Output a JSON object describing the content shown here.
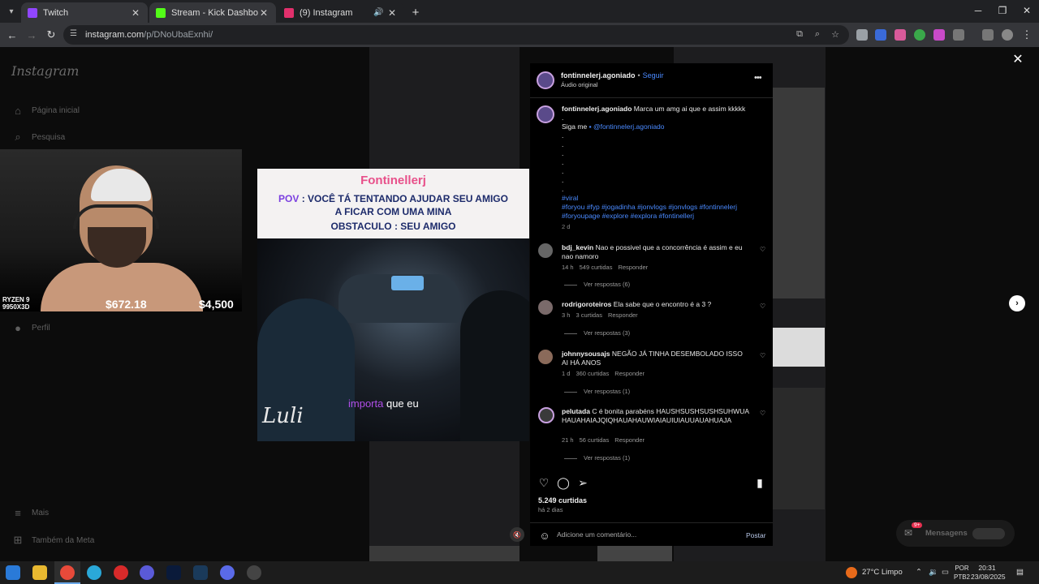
{
  "browser": {
    "tabs": [
      {
        "title": "Twitch",
        "color": "#9146ff"
      },
      {
        "title": "Stream - Kick Dashboard",
        "color": "#53fc18"
      },
      {
        "title": "(9) Instagram",
        "color": "#e1306c"
      }
    ],
    "url_host": "instagram.com",
    "url_path": "/p/DNoUbaExnhi/"
  },
  "sidebar": {
    "logo": "Instagram",
    "items": [
      {
        "label": "Página inicial",
        "icon": "home-icon"
      },
      {
        "label": "Pesquisa",
        "icon": "search-icon"
      },
      {
        "label": "Perfil",
        "icon": "profile-icon"
      },
      {
        "label": "Mais",
        "icon": "menu-icon"
      },
      {
        "label": "Também da Meta",
        "icon": "meta-icon"
      }
    ]
  },
  "webcam": {
    "rig_line1": "RYZEN 9",
    "rig_line2": "9950X3D",
    "money1": "$672.18",
    "money2": "$4,500"
  },
  "video": {
    "brand": "Fontinellerj",
    "line2_pov": "POV",
    "line2_rest": " : VOCÊ TÁ TENTANDO AJUDAR SEU AMIGO",
    "line3": "A FICAR COM UMA MINA",
    "line4": "OBSTACULO : SEU AMIGO",
    "caption_highlight": "importa",
    "caption_rest": " que eu",
    "signature": "Luli"
  },
  "post": {
    "username": "fontinnelerj.agoniado",
    "follow": "Seguir",
    "audio": "Áudio original",
    "caption_text": "Marca um amg ai que e assim kkkkk",
    "siga_me": "Siga me",
    "mention": "@fontinnelerj.agoniado",
    "hashtags_1": "#viral",
    "hashtags_2": "#foryou #fyp #jogadinha #jonvlogs #jonvlogs #fontinnelerj",
    "hashtags_3": "#foryoupage #explore #explora #fontinellerj",
    "caption_age": "2 d",
    "likes": "5.249 curtidas",
    "post_age": "há 2 dias",
    "comment_placeholder": "Adicione um comentário...",
    "post_button": "Postar"
  },
  "comments": [
    {
      "user": "bdj_kevin",
      "text": "Nao e possivel que a concorrência é assim e eu nao namoro",
      "age": "14 h",
      "likes": "549 curtidas",
      "reply": "Responder",
      "replies": "Ver respostas (6)"
    },
    {
      "user": "rodrigoroteiros",
      "text": "Ela sabe que o encontro é a 3 ?",
      "age": "3 h",
      "likes": "3 curtidas",
      "reply": "Responder",
      "replies": "Ver respostas (3)"
    },
    {
      "user": "johnnysousajs",
      "text": "NEGÃO JÁ TINHA DESEMBOLADO ISSO AI HÁ ANOS",
      "age": "1 d",
      "likes": "360 curtidas",
      "reply": "Responder",
      "replies": "Ver respostas (1)"
    },
    {
      "user": "pelutada",
      "text": "C é bonita parabéns HAUSHSUSHSUSHSUHWUAHAUAHAIAJQIQHAUAHAUWIAIAUIUIAUUAUAHUAJA",
      "age": "21 h",
      "likes": "56 curtidas",
      "reply": "Responder",
      "replies": "Ver respostas (1)"
    }
  ],
  "messages": {
    "label": "Mensagens",
    "badge": "9+"
  },
  "taskbar": {
    "weather": "27°C  Limpo",
    "lang_1": "POR",
    "lang_2": "PTB2",
    "time": "20:31",
    "date": "23/08/2025"
  }
}
